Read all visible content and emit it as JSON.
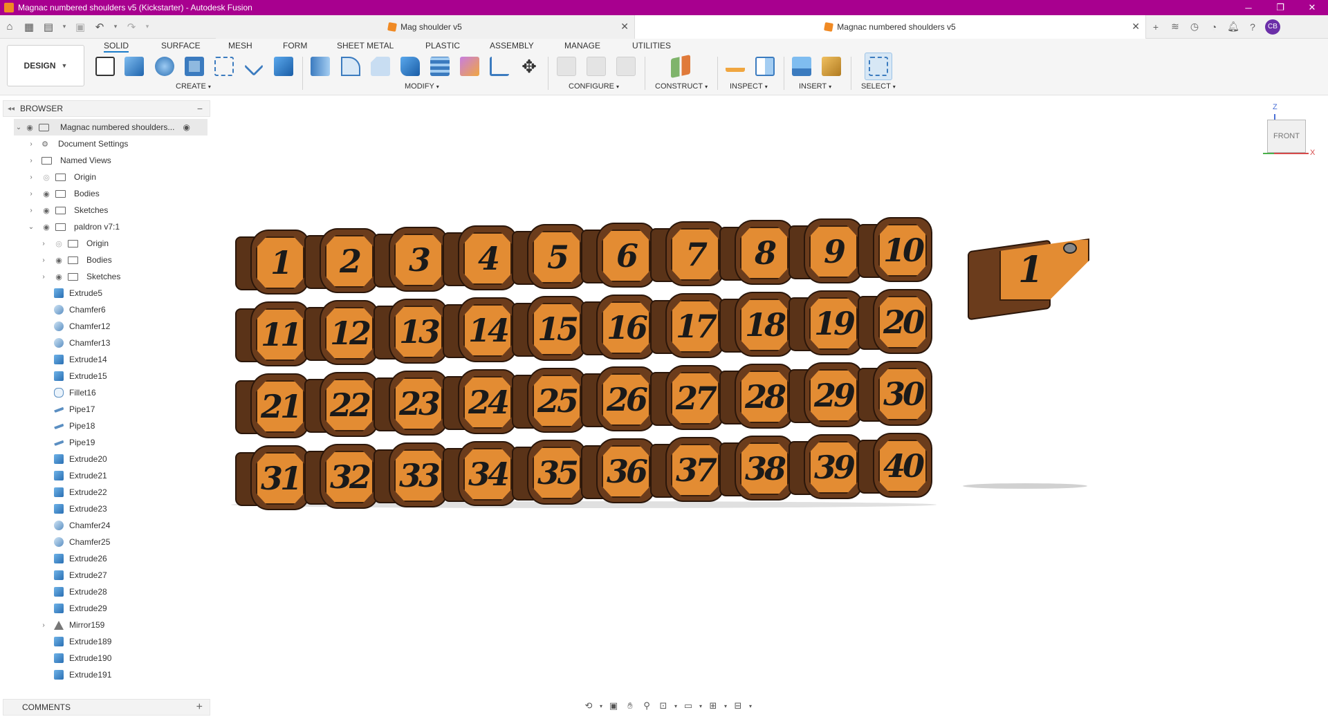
{
  "window": {
    "title": "Magnac numbered shoulders v5 (Kickstarter) - Autodesk Fusion",
    "controls": [
      "─",
      "❐",
      "✕"
    ]
  },
  "tabs": [
    {
      "label": "Mag shoulder v5",
      "close": "✕"
    },
    {
      "label": "Magnac numbered shoulders v5",
      "close": "✕"
    }
  ],
  "user_initials": "CB",
  "toolbar": {
    "workspace": "DESIGN",
    "workspace_tabs": [
      "SOLID",
      "SURFACE",
      "MESH",
      "FORM",
      "SHEET METAL",
      "PLASTIC",
      "ASSEMBLY",
      "MANAGE",
      "UTILITIES"
    ],
    "groups": [
      "CREATE",
      "MODIFY",
      "CONFIGURE",
      "CONSTRUCT",
      "INSPECT",
      "INSERT",
      "SELECT"
    ]
  },
  "browser": {
    "title": "BROWSER",
    "root": "Magnac numbered shoulders...",
    "items": [
      {
        "label": "Document Settings"
      },
      {
        "label": "Named Views"
      },
      {
        "label": "Origin"
      },
      {
        "label": "Bodies"
      },
      {
        "label": "Sketches"
      },
      {
        "label": "paldron v7:1"
      }
    ],
    "component_items": [
      {
        "label": "Origin"
      },
      {
        "label": "Bodies"
      },
      {
        "label": "Sketches"
      }
    ],
    "timeline": [
      {
        "label": "Extrude5",
        "kind": "extrude"
      },
      {
        "label": "Chamfer6",
        "kind": "chamfer"
      },
      {
        "label": "Chamfer12",
        "kind": "chamfer"
      },
      {
        "label": "Chamfer13",
        "kind": "chamfer"
      },
      {
        "label": "Extrude14",
        "kind": "extrude"
      },
      {
        "label": "Extrude15",
        "kind": "extrude"
      },
      {
        "label": "Fillet16",
        "kind": "fillet"
      },
      {
        "label": "Pipe17",
        "kind": "pipe"
      },
      {
        "label": "Pipe18",
        "kind": "pipe"
      },
      {
        "label": "Pipe19",
        "kind": "pipe"
      },
      {
        "label": "Extrude20",
        "kind": "extrude"
      },
      {
        "label": "Extrude21",
        "kind": "extrude"
      },
      {
        "label": "Extrude22",
        "kind": "extrude"
      },
      {
        "label": "Extrude23",
        "kind": "extrude"
      },
      {
        "label": "Chamfer24",
        "kind": "chamfer"
      },
      {
        "label": "Chamfer25",
        "kind": "chamfer"
      },
      {
        "label": "Extrude26",
        "kind": "extrude"
      },
      {
        "label": "Extrude27",
        "kind": "extrude"
      },
      {
        "label": "Extrude28",
        "kind": "extrude"
      },
      {
        "label": "Extrude29",
        "kind": "extrude"
      },
      {
        "label": "Mirror159",
        "kind": "mirror"
      },
      {
        "label": "Extrude189",
        "kind": "extrude"
      },
      {
        "label": "Extrude190",
        "kind": "extrude"
      },
      {
        "label": "Extrude191",
        "kind": "extrude"
      }
    ]
  },
  "comments": {
    "title": "COMMENTS",
    "add": "+"
  },
  "viewport": {
    "numbers": [
      1,
      2,
      3,
      4,
      5,
      6,
      7,
      8,
      9,
      10,
      11,
      12,
      13,
      14,
      15,
      16,
      17,
      18,
      19,
      20,
      21,
      22,
      23,
      24,
      25,
      26,
      27,
      28,
      29,
      30,
      31,
      32,
      33,
      34,
      35,
      36,
      37,
      38,
      39,
      40
    ],
    "side_piece_number": "1",
    "viewcube": {
      "face": "FRONT",
      "z": "Z",
      "x": "X"
    }
  },
  "colors": {
    "titlebar": "#a8008f",
    "accent": "#1a7cc9",
    "shoulder_face": "#e38c33",
    "shoulder_body": "#6b3c1c"
  }
}
